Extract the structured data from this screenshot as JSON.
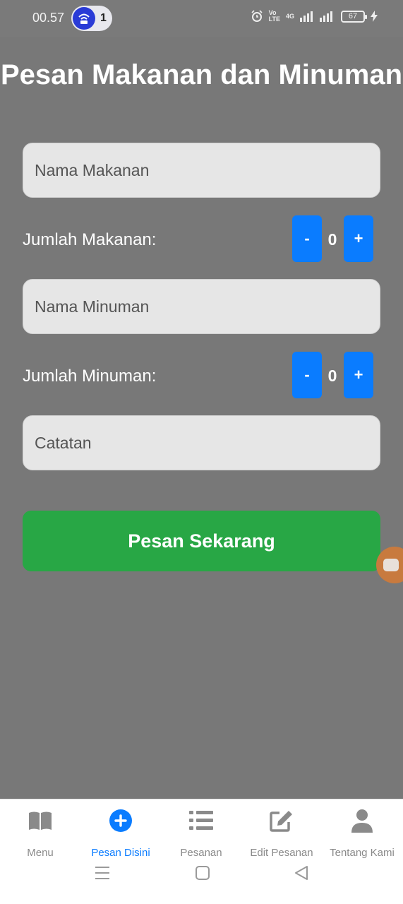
{
  "status_bar": {
    "time": "00.57",
    "notification_count": "1",
    "network_top": "Vo",
    "network_bottom": "LTE",
    "network_gen": "4G",
    "battery": "67"
  },
  "page": {
    "title": "Pesan Makanan dan Minuman"
  },
  "form": {
    "food_name_placeholder": "Nama Makanan",
    "food_qty_label": "Jumlah Makanan:",
    "food_qty_value": "0",
    "drink_name_placeholder": "Nama Minuman",
    "drink_qty_label": "Jumlah Minuman:",
    "drink_qty_value": "0",
    "notes_placeholder": "Catatan",
    "decrement_label": "-",
    "increment_label": "+",
    "submit_label": "Pesan Sekarang"
  },
  "bottom_nav": {
    "items": [
      {
        "label": "Menu",
        "icon": "book-icon",
        "active": false
      },
      {
        "label": "Pesan Disini",
        "icon": "plus-circle-icon",
        "active": true
      },
      {
        "label": "Pesanan",
        "icon": "list-icon",
        "active": false
      },
      {
        "label": "Edit Pesanan",
        "icon": "edit-icon",
        "active": false
      },
      {
        "label": "Tentang Kami",
        "icon": "user-icon",
        "active": false
      }
    ]
  },
  "colors": {
    "background": "#787878",
    "accent": "#0a7cff",
    "submit": "#28a745",
    "nav_inactive": "#8a8a8a"
  }
}
